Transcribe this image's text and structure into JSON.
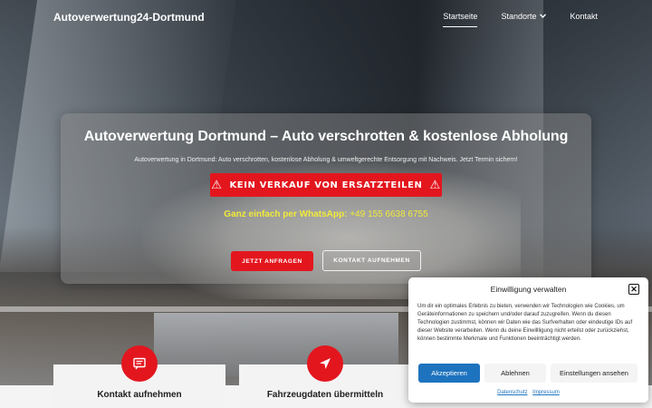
{
  "header": {
    "brand": "Autoverwertung24-Dortmund",
    "nav": [
      {
        "label": "Startseite",
        "active": true
      },
      {
        "label": "Standorte",
        "has_dropdown": true
      },
      {
        "label": "Kontakt"
      }
    ]
  },
  "hero": {
    "title": "Autoverwertung Dortmund – Auto verschrotten & kostenlose Abholung",
    "subtitle": "Autoverwertung in Dortmund: Auto verschrotten, kostenlose Abholung & umweltgerechte Entsorgung mit Nachweis. Jetzt Termin sichern!",
    "warning": "KEIN VERKAUF VON ERSATZTEILEN",
    "whatsapp_label": "Ganz einfach per WhatsApp:",
    "whatsapp_number": "+49 155 6638 6755",
    "cta_primary": "JETZT ANFRAGEN",
    "cta_secondary": "KONTAKT AUFNEHMEN"
  },
  "features": [
    {
      "title": "Kontakt aufnehmen",
      "icon": "message-icon"
    },
    {
      "title": "Fahrzeugdaten übermitteln",
      "icon": "navigation-arrow-icon"
    }
  ],
  "consent": {
    "title": "Einwilligung verwalten",
    "text": "Um dir ein optimales Erlebnis zu bieten, verwenden wir Technologien wie Cookies, um Geräteinformationen zu speichern und/oder darauf zuzugreifen. Wenn du diesen Technologien zustimmst, können wir Daten wie das Surfverhalten oder eindeutige IDs auf dieser Website verarbeiten. Wenn du deine Einwillligung nicht erteilst oder zurückziehst, können bestimmte Merkmale und Funktionen beeinträchtigt werden.",
    "accept": "Akzeptieren",
    "deny": "Ablehnen",
    "settings": "Einstellungen ansehen",
    "privacy": "Datenschutz",
    "imprint": "Impressum"
  },
  "colors": {
    "accent_red": "#e3161e",
    "whatsapp_yellow": "#f2ea3a",
    "consent_blue": "#1e73be"
  }
}
